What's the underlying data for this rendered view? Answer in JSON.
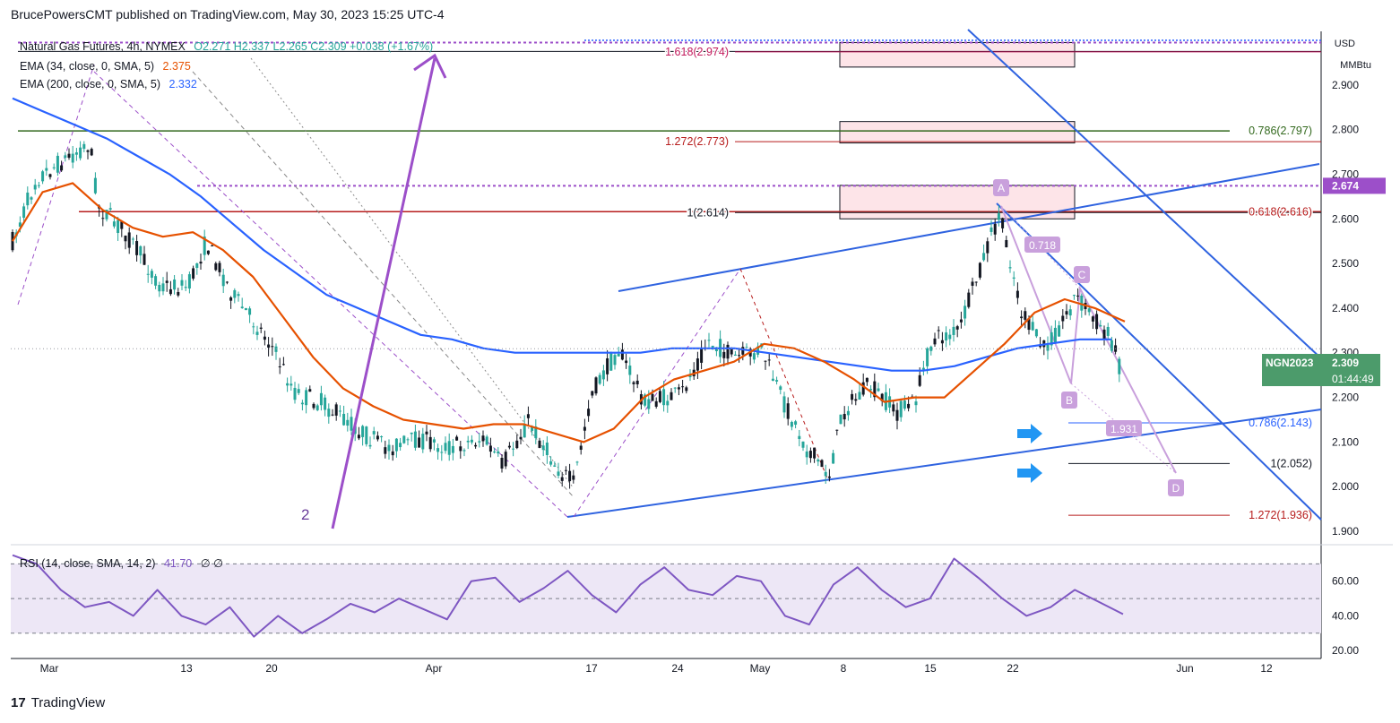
{
  "header": {
    "text": "BrucePowersCMT published on TradingView.com, May 30, 2023 15:25 UTC-4"
  },
  "legend": {
    "symbol": "Natural Gas Futures, 4h, NYMEX",
    "ohlc": "O2.271  H2.337  L2.265  C2.309  +0.038 (+1.67%)",
    "ema1": "EMA (34, close, 0, SMA, 5)",
    "ema1_value": "2.375",
    "ema2": "EMA (200, close, 0, SMA, 5)",
    "ema2_value": "2.332",
    "rsi": "RSI (14, close, SMA, 14, 2)",
    "rsi_value": "41.70",
    "rsi_extra": "∅ ∅"
  },
  "axis_unit": {
    "currency": "USD",
    "unit": "MMBtu"
  },
  "footer": {
    "brand": "TradingView",
    "logo": "17"
  },
  "price_tag": {
    "symbol": "NGN2023",
    "price": "2.309",
    "countdown": "01:44:49",
    "top_marker": "2.674"
  },
  "colors": {
    "up": "#26a69a",
    "down": "#131722",
    "ema34": "#e65100",
    "ema200": "#2962ff",
    "trend": "#2f63e0",
    "fib_red": "#b71c1c",
    "fib_green": "#33691e",
    "purple": "#9c4fc9",
    "tag_green": "#4c9b6b",
    "rsi": "#7e57c2"
  },
  "chart_data": {
    "type": "line",
    "title": "Natural Gas Futures, 4h, NYMEX",
    "x_ticks": [
      "Mar",
      "13",
      "20",
      "Apr",
      "17",
      "24",
      "May",
      "8",
      "15",
      "22",
      "Jun",
      "12"
    ],
    "y_ticks": [
      "2.900",
      "2.800",
      "2.700",
      "2.600",
      "2.500",
      "2.400",
      "2.300",
      "2.200",
      "2.100",
      "2.000",
      "1.900"
    ],
    "ylim": [
      1.87,
      3.02
    ],
    "rsi_ticks": [
      "60.00",
      "40.00",
      "20.00"
    ],
    "rsi_lim": [
      18,
      80
    ],
    "levels": [
      {
        "label": "1.618(2.974)",
        "value": 2.974,
        "color": "#c2185b"
      },
      {
        "label": "1.272(2.773)",
        "value": 2.773,
        "color": "#b71c1c"
      },
      {
        "label": "1(2.614)",
        "value": 2.614,
        "color": "#131722"
      },
      {
        "label": "0.786(2.797)",
        "value": 2.797,
        "color": "#33691e"
      },
      {
        "label": "0.618(2.616)",
        "value": 2.616,
        "color": "#b71c1c"
      },
      {
        "label": "0.786(2.143)",
        "value": 2.143,
        "color": "#2962ff"
      },
      {
        "label": "1(2.052)",
        "value": 2.052,
        "color": "#131722"
      },
      {
        "label": "1.272(1.936)",
        "value": 1.936,
        "color": "#b71c1c"
      }
    ],
    "pattern_points": [
      "A",
      "B",
      "C",
      "D"
    ],
    "pattern_ratios": [
      "0.718",
      "1.931"
    ],
    "wave_label": "2",
    "ema34": [
      2.55,
      2.66,
      2.68,
      2.62,
      2.58,
      2.56,
      2.57,
      2.53,
      2.47,
      2.38,
      2.29,
      2.22,
      2.18,
      2.15,
      2.14,
      2.13,
      2.14,
      2.14,
      2.12,
      2.1,
      2.13,
      2.2,
      2.24,
      2.26,
      2.28,
      2.32,
      2.31,
      2.28,
      2.24,
      2.19,
      2.2,
      2.2,
      2.26,
      2.32,
      2.39,
      2.42,
      2.4,
      2.37
    ],
    "ema200": [
      2.87,
      2.84,
      2.81,
      2.78,
      2.74,
      2.7,
      2.65,
      2.59,
      2.53,
      2.48,
      2.43,
      2.4,
      2.37,
      2.34,
      2.33,
      2.31,
      2.3,
      2.3,
      2.3,
      2.3,
      2.3,
      2.31,
      2.31,
      2.31,
      2.3,
      2.29,
      2.28,
      2.27,
      2.26,
      2.26,
      2.27,
      2.29,
      2.31,
      2.32,
      2.33,
      2.33
    ],
    "rsi": [
      75,
      70,
      55,
      45,
      48,
      40,
      55,
      40,
      35,
      45,
      28,
      40,
      30,
      38,
      47,
      42,
      50,
      44,
      38,
      60,
      62,
      48,
      56,
      66,
      52,
      42,
      58,
      68,
      55,
      52,
      63,
      60,
      40,
      35,
      58,
      68,
      55,
      45,
      50,
      73,
      62,
      50,
      40,
      45,
      55,
      48,
      41
    ]
  }
}
